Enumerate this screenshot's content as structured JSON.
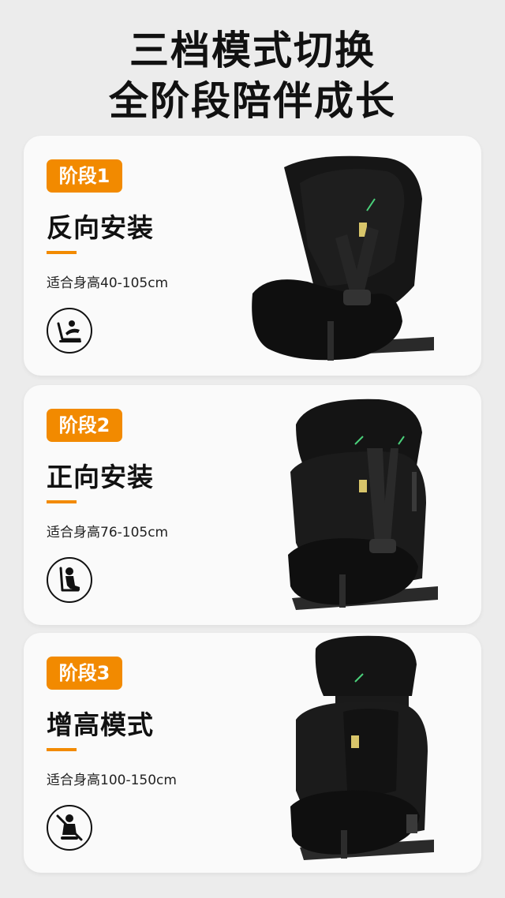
{
  "header": {
    "title_line1": "三档模式切换",
    "title_line2": "全阶段陪伴成长"
  },
  "stages": [
    {
      "badge": "阶段1",
      "mode": "反向安装",
      "height": "适合身高40-105cm",
      "icon": "rear-facing-infant-seat-icon"
    },
    {
      "badge": "阶段2",
      "mode": "正向安装",
      "height": "适合身高76-105cm",
      "icon": "forward-facing-child-seat-icon"
    },
    {
      "badge": "阶段3",
      "mode": "增高模式",
      "height": "适合身高100-150cm",
      "icon": "booster-seatbelt-icon"
    }
  ],
  "colors": {
    "accent": "#f28a00",
    "background": "#ececec",
    "card": "#fafafa",
    "text": "#111111"
  }
}
